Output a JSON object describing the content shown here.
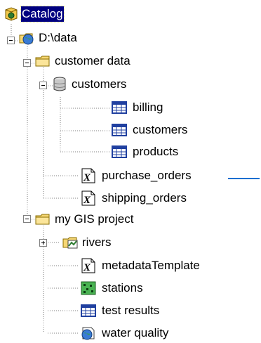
{
  "tree": {
    "root": {
      "label": "Catalog",
      "icon": "catalog-icon"
    },
    "connection": {
      "label": "D:\\data",
      "icon": "globe-folder-connection-icon"
    },
    "customer_data": {
      "label": "customer data",
      "icon": "folder-icon",
      "database": {
        "label": "customers",
        "icon": "database-icon",
        "tables": [
          {
            "label": "billing",
            "icon": "table-icon"
          },
          {
            "label": "customers",
            "icon": "table-icon"
          },
          {
            "label": "products",
            "icon": "table-icon"
          }
        ]
      },
      "files": [
        {
          "label": "purchase_orders",
          "icon": "xml-document-icon"
        },
        {
          "label": "shipping_orders",
          "icon": "xml-document-icon"
        }
      ]
    },
    "gis_project": {
      "label": "my GIS project",
      "icon": "folder-icon",
      "items": [
        {
          "label": "rivers",
          "icon": "coverage-icon"
        },
        {
          "label": "metadataTemplate",
          "icon": "xml-document-icon"
        },
        {
          "label": "stations",
          "icon": "raster-grid-icon"
        },
        {
          "label": "test results",
          "icon": "table-icon"
        },
        {
          "label": "water quality",
          "icon": "layer-file-icon"
        }
      ]
    }
  },
  "colors": {
    "selection": "#000080",
    "callout": "#1c6fd1",
    "folder": "#f6d774",
    "table": "#2040a0"
  }
}
